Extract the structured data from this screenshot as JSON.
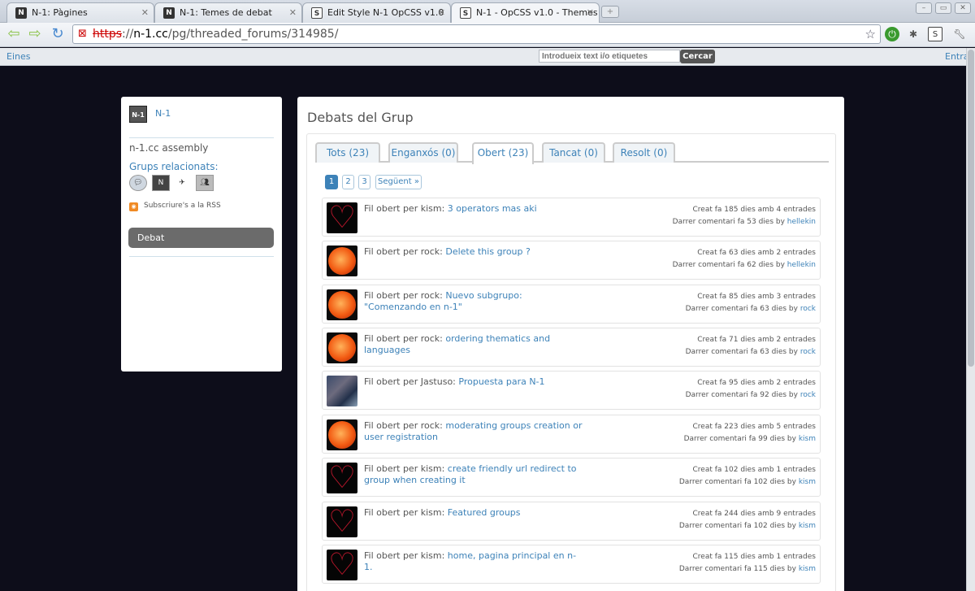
{
  "browser": {
    "tabs": [
      {
        "title": "N-1: Pàgines",
        "favicon": "n1"
      },
      {
        "title": "N-1: Temes de debat",
        "favicon": "n1"
      },
      {
        "title": "Edit Style N-1 OpCSS v1.0",
        "favicon": "stylish"
      },
      {
        "title": "N-1 - OpCSS v1.0 - Themes",
        "favicon": "stylish"
      }
    ],
    "url_proto": "https",
    "url_host": "n-1.cc",
    "url_path": "/pg/threaded_forums/314985/"
  },
  "topbar": {
    "tools_label": "Eines",
    "search_placeholder": "Introdueix text i/o etiquetes",
    "search_button": "Cercar",
    "login_label": "Entra"
  },
  "sidebar": {
    "logo_text": "N-1",
    "group_name": "N-1",
    "description": "n-1.cc assembly",
    "related_label": "Grups relacionats:",
    "rss_label": "Subscriure's a la RSS",
    "debate_button": "Debat"
  },
  "main": {
    "title": "Debats del Grup",
    "tabs": [
      {
        "label": "Tots (23)"
      },
      {
        "label": "Enganxós (0)"
      },
      {
        "label": "Obert (23)"
      },
      {
        "label": "Tancat (0)"
      },
      {
        "label": "Resolt (0)"
      }
    ],
    "pagination": [
      "1",
      "2",
      "3",
      "Següent »"
    ],
    "topics": [
      {
        "prefix": "Fil obert per kism: ",
        "title": "3 operators mas aki",
        "created": "Creat fa 185 dies amb 4 entrades",
        "last": "Darrer comentari fa 53 dies by ",
        "user": "hellekin",
        "avatar": "heart"
      },
      {
        "prefix": "Fil obert per rock: ",
        "title": "Delete this group ?",
        "created": "Creat fa 63 dies amb 2 entrades",
        "last": "Darrer comentari fa 62 dies by ",
        "user": "hellekin",
        "avatar": "sun"
      },
      {
        "prefix": "Fil obert per rock: ",
        "title": "Nuevo subgrupo: \"Comenzando en n-1\"",
        "created": "Creat fa 85 dies amb 3 entrades",
        "last": "Darrer comentari fa 63 dies by ",
        "user": "rock",
        "avatar": "sun"
      },
      {
        "prefix": "Fil obert per rock: ",
        "title": "ordering thematics and languages",
        "created": "Creat fa 71 dies amb 2 entrades",
        "last": "Darrer comentari fa 63 dies by ",
        "user": "rock",
        "avatar": "sun"
      },
      {
        "prefix": "Fil obert per Jastuso: ",
        "title": "Propuesta para N-1",
        "created": "Creat fa 95 dies amb 2 entrades",
        "last": "Darrer comentari fa 92 dies by ",
        "user": "rock",
        "avatar": "photo"
      },
      {
        "prefix": "Fil obert per rock: ",
        "title": "moderating groups creation or user registration",
        "created": "Creat fa 223 dies amb 5 entrades",
        "last": "Darrer comentari fa 99 dies by ",
        "user": "kism",
        "avatar": "sun"
      },
      {
        "prefix": "Fil obert per kism: ",
        "title": "create friendly url redirect to group when creating it",
        "created": "Creat fa 102 dies amb 1 entrades",
        "last": "Darrer comentari fa 102 dies by ",
        "user": "kism",
        "avatar": "heart"
      },
      {
        "prefix": "Fil obert per kism: ",
        "title": "Featured groups",
        "created": "Creat fa 244 dies amb 9 entrades",
        "last": "Darrer comentari fa 102 dies by ",
        "user": "kism",
        "avatar": "heart"
      },
      {
        "prefix": "Fil obert per kism: ",
        "title": "home, pagina principal en n-1.",
        "created": "Creat fa 115 dies amb 1 entrades",
        "last": "Darrer comentari fa 115 dies by ",
        "user": "kism",
        "avatar": "heart"
      }
    ]
  }
}
